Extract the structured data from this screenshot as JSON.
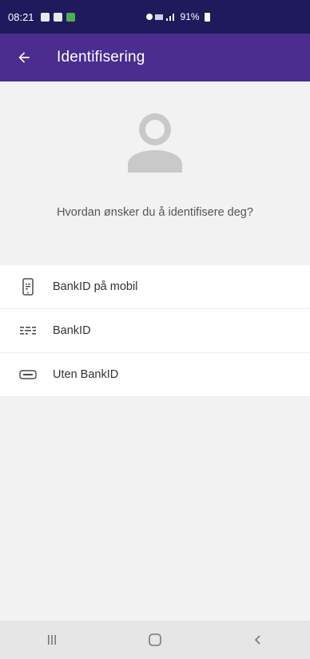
{
  "status_bar": {
    "time": "08:21",
    "battery": "91%"
  },
  "app_bar": {
    "title": "Identifisering"
  },
  "hero": {
    "prompt": "Hvordan ønsker du å identifisere deg?"
  },
  "options": [
    {
      "label": "BankID på mobil",
      "icon": "mobile-bankid-icon"
    },
    {
      "label": "BankID",
      "icon": "bankid-icon"
    },
    {
      "label": "Uten BankID",
      "icon": "card-icon"
    }
  ],
  "colors": {
    "status_bar": "#1f1a5c",
    "app_bar": "#4a2d8f",
    "background": "#f2f2f2"
  }
}
